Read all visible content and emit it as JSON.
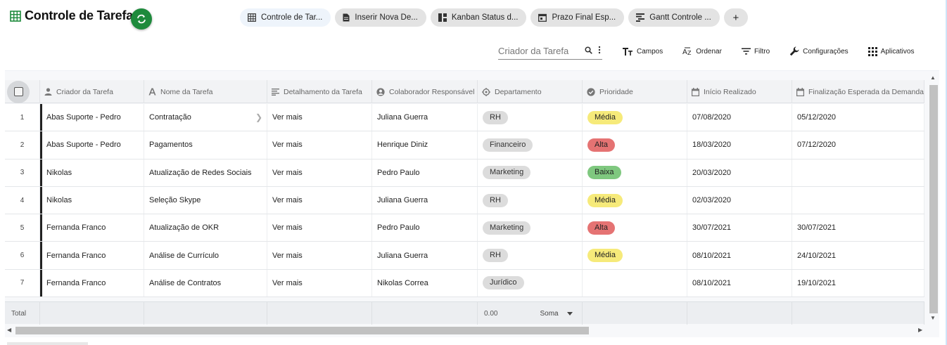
{
  "header": {
    "title": "Controle de Tarefas",
    "views": [
      {
        "label": "Controle de Tar...",
        "icon": "grid-icon",
        "active": true
      },
      {
        "label": "Inserir Nova De...",
        "icon": "form-icon",
        "active": false
      },
      {
        "label": "Kanban Status d...",
        "icon": "kanban-icon",
        "active": false
      },
      {
        "label": "Prazo Final Esp...",
        "icon": "calendar-icon",
        "active": false
      },
      {
        "label": "Gantt Controle ...",
        "icon": "gantt-icon",
        "active": false
      }
    ],
    "add_view_label": "+"
  },
  "toolbar": {
    "search_placeholder": "Criador da Tarefa",
    "fields_label": "Campos",
    "sort_label": "Ordenar",
    "filter_label": "Filtro",
    "settings_label": "Configurações",
    "apps_label": "Aplicativos"
  },
  "table": {
    "columns": [
      {
        "label": "Criador da Tarefa",
        "icon": "person-icon"
      },
      {
        "label": "Nome da Tarefa",
        "icon": "text-icon"
      },
      {
        "label": "Detalhamento da Tarefa",
        "icon": "long-text-icon"
      },
      {
        "label": "Colaborador Responsável",
        "icon": "user-circle-icon"
      },
      {
        "label": "Departamento",
        "icon": "target-icon"
      },
      {
        "label": "Prioridade",
        "icon": "check-circle-icon"
      },
      {
        "label": "Início Realizado",
        "icon": "calendar-icon"
      },
      {
        "label": "Finalização Esperada da Demanda",
        "icon": "calendar-icon"
      }
    ],
    "rows": [
      {
        "num": "1",
        "creator": "Abas Suporte - Pedro",
        "task": "Contratação",
        "detail": "Ver mais",
        "assignee": "Juliana Guerra",
        "dept": "RH",
        "priority": "Média",
        "start": "07/08/2020",
        "end": "05/12/2020"
      },
      {
        "num": "2",
        "creator": "Abas Suporte - Pedro",
        "task": "Pagamentos",
        "detail": "Ver mais",
        "assignee": "Henrique Diniz",
        "dept": "Financeiro",
        "priority": "Alta",
        "start": "18/03/2020",
        "end": "07/12/2020"
      },
      {
        "num": "3",
        "creator": "Nikolas",
        "task": "Atualização de Redes Sociais",
        "detail": "Ver mais",
        "assignee": "Pedro Paulo",
        "dept": "Marketing",
        "priority": "Baixa",
        "start": "20/03/2020",
        "end": ""
      },
      {
        "num": "4",
        "creator": "Nikolas",
        "task": "Seleção Skype",
        "detail": "Ver mais",
        "assignee": "Juliana Guerra",
        "dept": "RH",
        "priority": "Média",
        "start": "02/03/2020",
        "end": ""
      },
      {
        "num": "5",
        "creator": "Fernanda Franco",
        "task": "Atualização de OKR",
        "detail": "Ver mais",
        "assignee": "Pedro Paulo",
        "dept": "Marketing",
        "priority": "Alta",
        "start": "30/07/2021",
        "end": "30/07/2021"
      },
      {
        "num": "6",
        "creator": "Fernanda Franco",
        "task": "Análise de Currículo",
        "detail": "Ver mais",
        "assignee": "Juliana Guerra",
        "dept": "RH",
        "priority": "Média",
        "start": "08/10/2021",
        "end": "24/10/2021"
      },
      {
        "num": "7",
        "creator": "Fernanda Franco",
        "task": "Análise de Contratos",
        "detail": "Ver mais",
        "assignee": "Nikolas Correa",
        "dept": "Jurídico",
        "priority": "",
        "start": "08/10/2021",
        "end": "19/10/2021"
      }
    ],
    "footer": {
      "total_label": "Total",
      "sum_value": "0.00",
      "agg_label": "Soma"
    }
  },
  "colors": {
    "sync_button": "#1e8a3c",
    "priority": {
      "Média": "#f6ea7a",
      "Alta": "#e57373",
      "Baixa": "#7fc87f"
    },
    "dept_pill": "#dcdcdc"
  }
}
